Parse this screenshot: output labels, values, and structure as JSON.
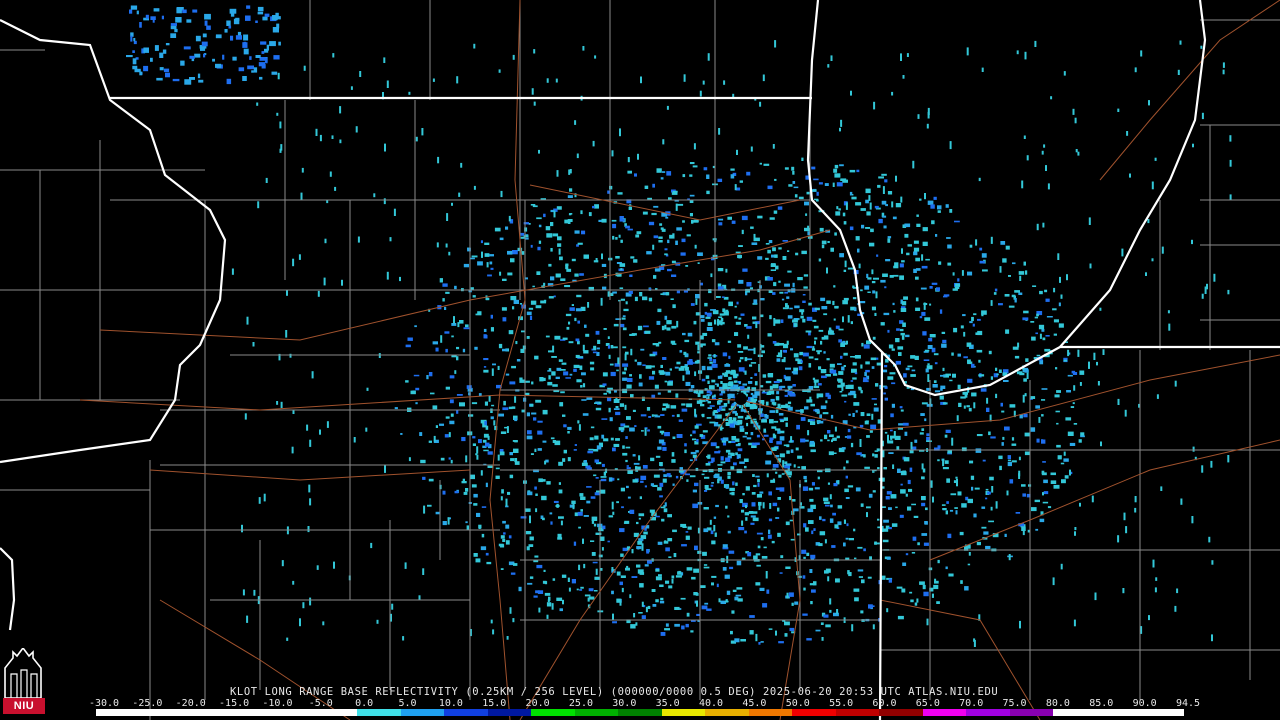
{
  "product": {
    "caption": "KLOT LONG RANGE BASE REFLECTIVITY (0.25KM / 256 LEVEL) (000000/0000 0.5 DEG) 2025-06-20 20:53 UTC  ATLAS.NIU.EDU",
    "station": "KLOT",
    "timestamp": "2025-06-20 20:53 UTC",
    "source": "ATLAS.NIU.EDU"
  },
  "logo": {
    "text": "NIU",
    "icon": "niu-castle-logo",
    "color": "#c8102e"
  },
  "legend": {
    "ticks": [
      "-30.0",
      "-25.0",
      "-20.0",
      "-15.0",
      "-10.0",
      "-5.0",
      "0.0",
      "5.0",
      "10.0",
      "15.0",
      "20.0",
      "25.0",
      "30.0",
      "35.0",
      "40.0",
      "45.0",
      "50.0",
      "55.0",
      "60.0",
      "65.0",
      "70.0",
      "75.0",
      "80.0",
      "85.0",
      "90.0",
      "94.5"
    ],
    "colors": [
      "#ffffff",
      "#ffffff",
      "#ffffff",
      "#ffffff",
      "#ffffff",
      "#ffffff",
      "#40e0e8",
      "#1fa0f0",
      "#1040e0",
      "#0018a0",
      "#00e000",
      "#00b000",
      "#008000",
      "#e8e800",
      "#e8b000",
      "#f07800",
      "#f00000",
      "#c00000",
      "#900000",
      "#f000f0",
      "#a000e0",
      "#8800b0",
      "#ffffff",
      "#ffffff",
      "#ffffff"
    ]
  },
  "map": {
    "colors": {
      "state_border": "#ffffff",
      "county_border": "#8a8a8a",
      "road": "#a0522d",
      "echo": "#33c8d8",
      "echo_strong": "#1e6ef0"
    }
  }
}
